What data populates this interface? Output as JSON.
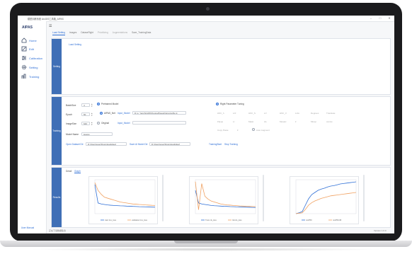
{
  "window": {
    "title": "模型训练系统 ArcGIS工具箱_AIPAS",
    "minimize": "–",
    "maximize": "□",
    "close": "✕"
  },
  "sidebar": {
    "brand": "AIPAS",
    "items": [
      {
        "label": "Home",
        "icon": "home-icon"
      },
      {
        "label": "Edit",
        "icon": "edit-icon"
      },
      {
        "label": "Calibration",
        "icon": "calibration-icon"
      },
      {
        "label": "Setting",
        "icon": "gear-icon"
      },
      {
        "label": "Training",
        "icon": "training-icon"
      }
    ],
    "footer": "User Manual"
  },
  "tabs": [
    {
      "label": "Load Setting",
      "active": true
    },
    {
      "label": "Images",
      "active": false
    },
    {
      "label": "DataseRight",
      "active": false
    },
    {
      "label": "Prioritizing",
      "active": false,
      "dim": true
    },
    {
      "label": "Augmentations",
      "active": false,
      "dim": true
    },
    {
      "label": "Save_TrainingData",
      "active": false
    }
  ],
  "setting_section": {
    "label": "Setting",
    "load_setting_link": "Load Setting"
  },
  "training_section": {
    "label": "Training",
    "batch_size_label": "BatchSize",
    "batch_size_value": "4",
    "epoch_label": "Epoch",
    "epoch_value": "50",
    "image_size_label": "ImageSize",
    "image_size_value": "640",
    "pretrained_label": "Pretrained Model",
    "aipas_label": "AIPAS_Net",
    "input_model_link": "Input_Model",
    "model_path": "D:\\u_Yanzhi\\AIPAS\\yolov8\\weights\\yolov8s.pt",
    "original_label": "Original",
    "input_model_link2": "Input_Model",
    "right_label": "Right Parameter Tuning",
    "model_name_label": "Model Name",
    "model_name_value": "leaves",
    "open_dataset_link": "Open Dataset Dir",
    "dataset_path": "D:\\Users\\user\\Downloads\\leaf",
    "save_model_link": "Save AI Model Dir",
    "save_model_path": "D:\\Users\\user\\Downloads\\leaf",
    "training_start": "TrainingStart",
    "stop_training": "Stop Training",
    "params_row1": [
      "HSV_h",
      "Lr0",
      "HSV_S",
      "Lrf",
      "HSV_V",
      "Lrdo",
      "Degrees",
      "Translate"
    ],
    "params_row2": [
      "Flipup",
      "Lr",
      "Mask",
      "cls",
      "Mosaic",
      "lr",
      "Mixup",
      "cutmix"
    ],
    "params_row3": [
      "Copy Paste",
      "lr",
      "Auto Augment"
    ]
  },
  "results_section": {
    "label": "Results",
    "tabs": [
      {
        "label": "Detail"
      },
      {
        "label": "Graph"
      }
    ]
  },
  "chart_data": [
    {
      "type": "line",
      "series": [
        {
          "name": "train box_loss",
          "values": [
            3.0,
            1.1,
            1.0,
            0.95,
            0.9,
            0.87,
            0.85,
            0.83,
            0.81,
            0.8,
            0.78,
            0.77,
            0.75,
            0.74,
            0.72,
            0.71,
            0.7,
            0.69,
            0.68,
            0.67
          ],
          "color": "#2f6fd6"
        },
        {
          "name": "validation box_loss",
          "values": [
            3.2,
            2.4,
            2.0,
            1.7,
            1.6,
            1.5,
            1.4,
            1.3,
            1.2,
            1.15,
            1.1,
            1.05,
            1.0,
            0.98,
            0.95,
            0.93,
            0.9,
            0.88,
            0.86,
            0.85
          ],
          "color": "#f0a060"
        }
      ],
      "ylim": [
        0,
        3.5
      ]
    },
    {
      "type": "line",
      "series": [
        {
          "name": "Train cls_loss",
          "values": [
            2.4,
            1.1,
            1.0,
            0.95,
            0.9,
            0.85,
            0.82,
            0.8,
            0.78,
            0.76,
            0.75,
            0.73,
            0.72,
            0.7,
            0.69,
            0.68,
            0.67,
            0.66,
            0.65,
            0.64
          ],
          "color": "#2f6fd6"
        },
        {
          "name": "Val cls_loss",
          "values": [
            3.3,
            0.4,
            3.1,
            1.8,
            1.5,
            1.3,
            1.2,
            1.1,
            1.0,
            0.95,
            0.9,
            0.88,
            0.85,
            0.83,
            0.8,
            0.78,
            0.76,
            0.75,
            0.74,
            0.73
          ],
          "color": "#f0a060"
        }
      ],
      "ylim": [
        0,
        3.5
      ]
    },
    {
      "type": "line",
      "series": [
        {
          "name": "mAP50",
          "values": [
            0.0,
            0.02,
            0.05,
            0.2,
            0.35,
            0.45,
            0.5,
            0.55,
            0.58,
            0.6,
            0.63,
            0.65,
            0.66,
            0.68,
            0.7,
            0.71,
            0.72,
            0.73,
            0.74,
            0.75
          ],
          "color": "#2f6fd6"
        },
        {
          "name": "mAP50-95",
          "values": [
            0.0,
            0.01,
            0.02,
            0.1,
            0.2,
            0.26,
            0.3,
            0.33,
            0.36,
            0.38,
            0.4,
            0.42,
            0.43,
            0.44,
            0.45,
            0.46,
            0.47,
            0.48,
            0.49,
            0.5
          ],
          "color": "#f0a060"
        }
      ],
      "ylim": [
        0,
        0.8
      ]
    }
  ],
  "status": {
    "left": "正在下载数据集合",
    "right": "Version 1.0.0"
  }
}
